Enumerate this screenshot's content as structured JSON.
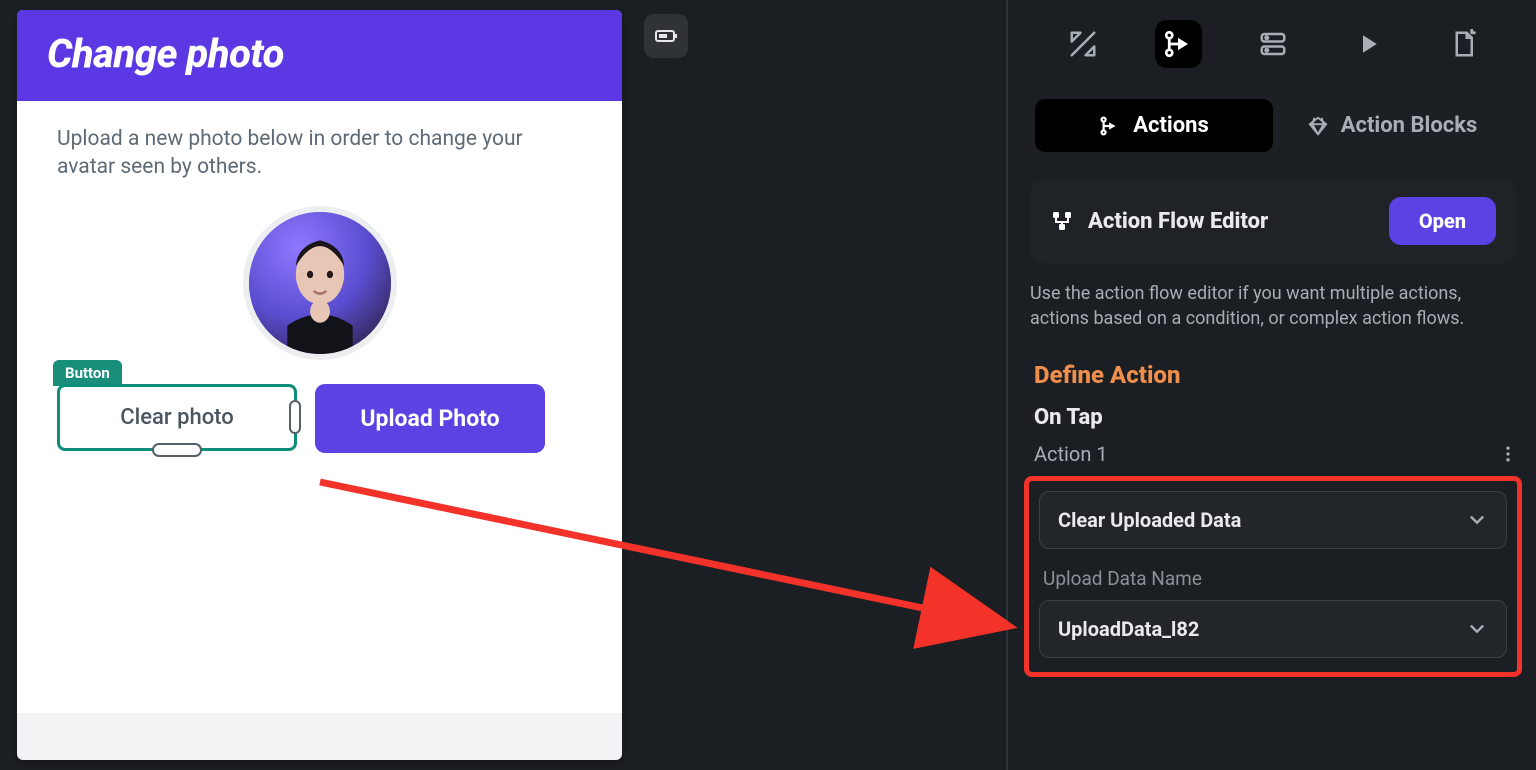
{
  "preview": {
    "header_title": "Change photo",
    "description": "Upload a new photo below in order to change your avatar seen by others.",
    "selection_label": "Button",
    "clear_button_label": "Clear photo",
    "upload_button_label": "Upload Photo"
  },
  "panel": {
    "segmented": {
      "actions": "Actions",
      "action_blocks": "Action Blocks"
    },
    "flow_editor": {
      "title": "Action Flow Editor",
      "open_label": "Open",
      "description": "Use the action flow editor if you want multiple actions, actions based on a condition, or complex action flows."
    },
    "define_action_title": "Define Action",
    "trigger_label": "On Tap",
    "action_index_label": "Action 1",
    "action_type_value": "Clear Uploaded Data",
    "upload_name_field_label": "Upload Data Name",
    "upload_name_value": "UploadData_l82"
  }
}
